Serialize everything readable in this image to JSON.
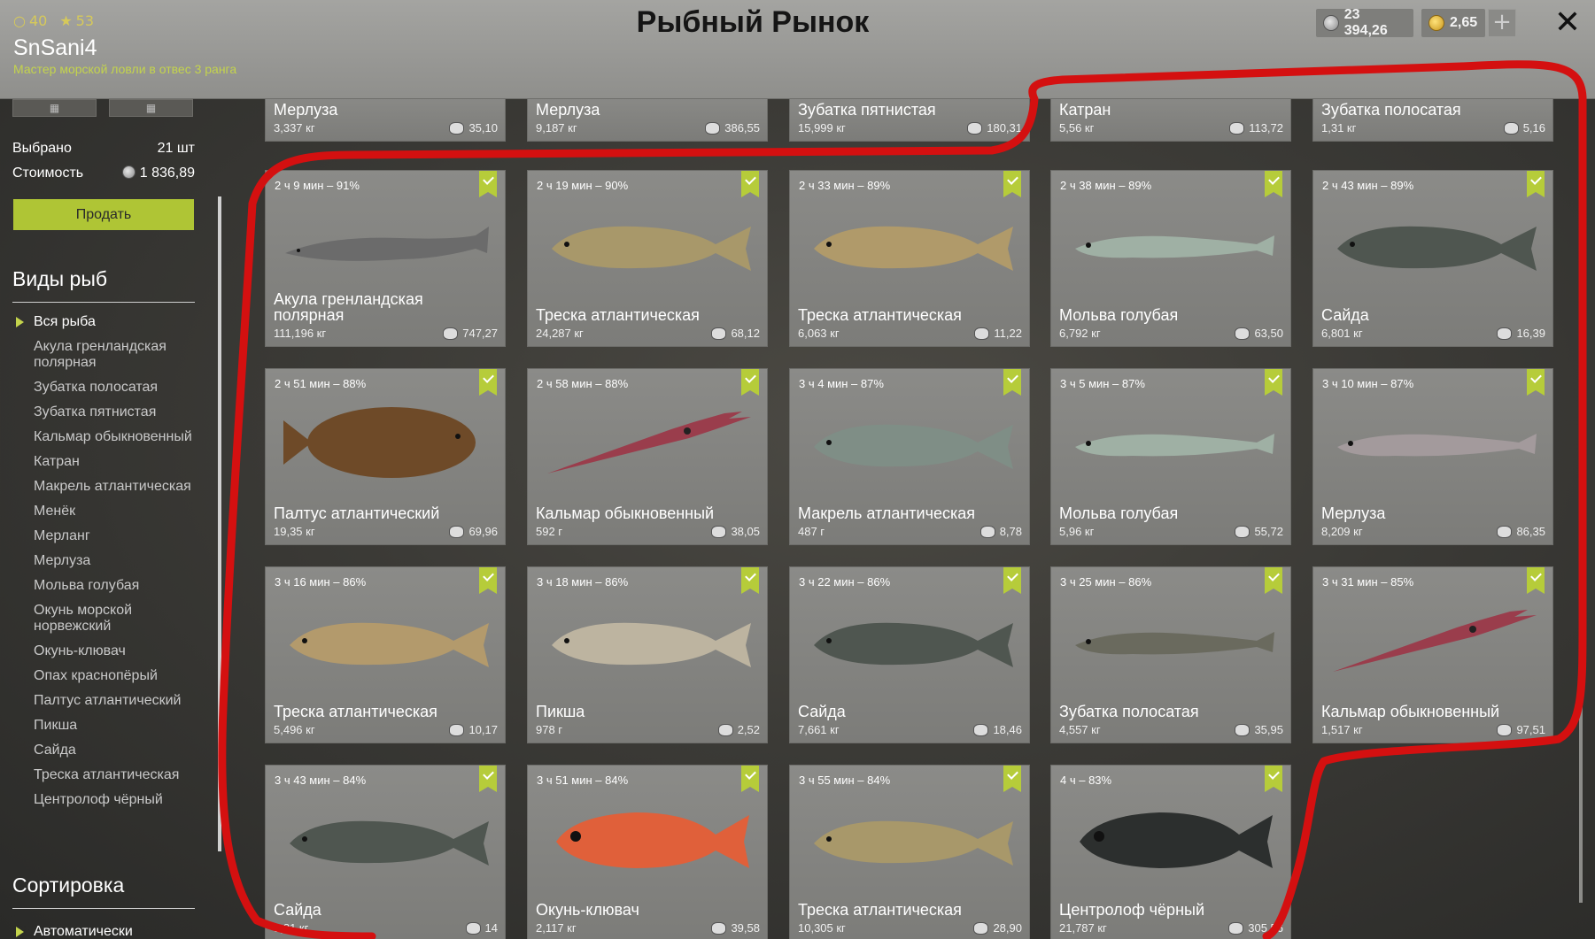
{
  "header": {
    "title": "Рыбный Рынок",
    "coins": "40",
    "stars": "53",
    "username": "SnSani4",
    "rank": "Мастер морской ловли в отвес 3 ранга",
    "silver": "23 394,26",
    "gold": "2,65",
    "plus": "+",
    "close": "✕"
  },
  "sidebar": {
    "selected_label": "Выбрано",
    "selected_value": "21 шт",
    "cost_label": "Стоимость",
    "cost_value": "1 836,89",
    "sell_button": "Продать",
    "species_title": "Виды рыб",
    "species": [
      "Вся рыба",
      "Акула гренландская полярная",
      "Зубатка полосатая",
      "Зубатка пятнистая",
      "Кальмар обыкновенный",
      "Катран",
      "Макрель атлантическая",
      "Менёк",
      "Мерланг",
      "Мерлуза",
      "Мольва голубая",
      "Окунь морской норвежский",
      "Окунь-клювач",
      "Опах краснопёрый",
      "Палтус атлантический",
      "Пикша",
      "Сайда",
      "Треска атлантическая",
      "Центролоф чёрный"
    ],
    "sort_title": "Сортировка",
    "sort_value": "Автоматически"
  },
  "top_row": [
    {
      "name": "Мерлуза",
      "weight": "3,337 кг",
      "price": "35,10"
    },
    {
      "name": "Мерлуза",
      "weight": "9,187 кг",
      "price": "386,55"
    },
    {
      "name": "Зубатка пятнистая",
      "weight": "15,999 кг",
      "price": "180,31"
    },
    {
      "name": "Катран",
      "weight": "5,56 кг",
      "price": "113,72"
    },
    {
      "name": "Зубатка полосатая",
      "weight": "1,31 кг",
      "price": "5,16"
    }
  ],
  "cards": [
    {
      "time": "2 ч 9 мин – 91%",
      "name": "Акула гренландская полярная",
      "weight": "111,196 кг",
      "price": "747,27",
      "color": "#6b6b6b",
      "kind": "shark"
    },
    {
      "time": "2 ч 19 мин – 90%",
      "name": "Треска атлантическая",
      "weight": "24,287 кг",
      "price": "68,12",
      "color": "#a8986a",
      "kind": "cod"
    },
    {
      "time": "2 ч 33 мин – 89%",
      "name": "Треска атлантическая",
      "weight": "6,063 кг",
      "price": "11,22",
      "color": "#b09a6a",
      "kind": "cod"
    },
    {
      "time": "2 ч 38 мин – 89%",
      "name": "Мольва голубая",
      "weight": "6,792 кг",
      "price": "63,50",
      "color": "#9fb0a4",
      "kind": "eel"
    },
    {
      "time": "2 ч 43 мин – 89%",
      "name": "Сайда",
      "weight": "6,801 кг",
      "price": "16,39",
      "color": "#4f5650",
      "kind": "cod"
    },
    {
      "time": "2 ч 51 мин – 88%",
      "name": "Палтус атлантический",
      "weight": "19,35 кг",
      "price": "69,96",
      "color": "#6e4a28",
      "kind": "flat"
    },
    {
      "time": "2 ч 58 мин – 88%",
      "name": "Кальмар обыкновенный",
      "weight": "592 г",
      "price": "38,05",
      "color": "#9a3d4c",
      "kind": "squid"
    },
    {
      "time": "3 ч 4 мин – 87%",
      "name": "Макрель атлантическая",
      "weight": "487 г",
      "price": "8,78",
      "color": "#7f8e86",
      "kind": "cod"
    },
    {
      "time": "3 ч 5 мин – 87%",
      "name": "Мольва голубая",
      "weight": "5,96 кг",
      "price": "55,72",
      "color": "#9fb0a4",
      "kind": "eel"
    },
    {
      "time": "3 ч 10 мин – 87%",
      "name": "Мерлуза",
      "weight": "8,209 кг",
      "price": "86,35",
      "color": "#a39a9c",
      "kind": "eel"
    },
    {
      "time": "3 ч 16 мин – 86%",
      "name": "Треска атлантическая",
      "weight": "5,496 кг",
      "price": "10,17",
      "color": "#b39a6c",
      "kind": "cod"
    },
    {
      "time": "3 ч 18 мин – 86%",
      "name": "Пикша",
      "weight": "978 г",
      "price": "2,52",
      "color": "#bdb4a0",
      "kind": "cod"
    },
    {
      "time": "3 ч 22 мин – 86%",
      "name": "Сайда",
      "weight": "7,661 кг",
      "price": "18,46",
      "color": "#4f5650",
      "kind": "cod"
    },
    {
      "time": "3 ч 25 мин – 86%",
      "name": "Зубатка полосатая",
      "weight": "4,557 кг",
      "price": "35,95",
      "color": "#6a6a5e",
      "kind": "eel"
    },
    {
      "time": "3 ч 31 мин – 85%",
      "name": "Кальмар обыкновенный",
      "weight": "1,517 кг",
      "price": "97,51",
      "color": "#9a3d4c",
      "kind": "squid"
    },
    {
      "time": "3 ч 43 мин – 84%",
      "name": "Сайда",
      "weight": "5,81 кг",
      "price": "14",
      "color": "#4f5650",
      "kind": "cod"
    },
    {
      "time": "3 ч 51 мин – 84%",
      "name": "Окунь-клювач",
      "weight": "2,117 кг",
      "price": "39,58",
      "color": "#e0603a",
      "kind": "perch"
    },
    {
      "time": "3 ч 55 мин – 84%",
      "name": "Треска атлантическая",
      "weight": "10,305 кг",
      "price": "28,90",
      "color": "#a8986a",
      "kind": "cod"
    },
    {
      "time": "4 ч – 83%",
      "name": "Центролоф чёрный",
      "weight": "21,787 кг",
      "price": "305,56",
      "color": "#2c2f2e",
      "kind": "perch"
    }
  ],
  "colors": {
    "accent": "#afc535",
    "annotation": "#d41010"
  }
}
